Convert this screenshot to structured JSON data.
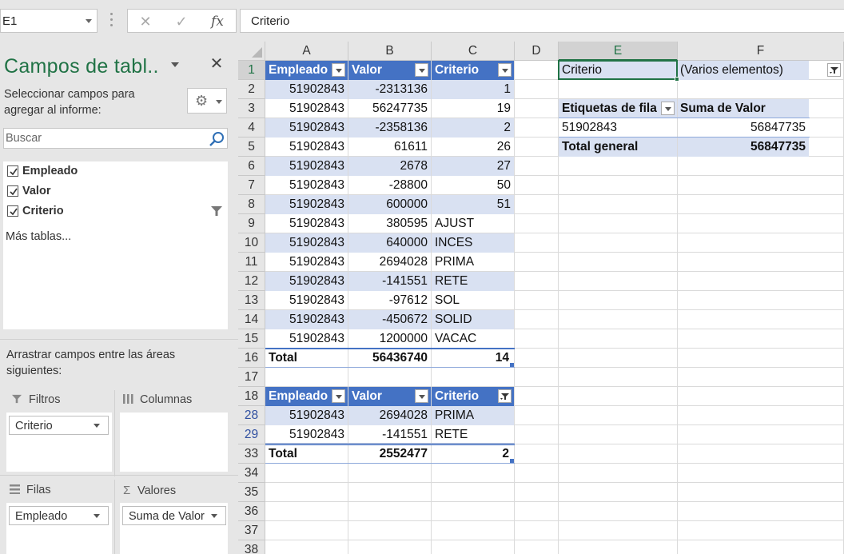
{
  "formula_bar": {
    "name_box": "E1",
    "fx_label": "fx",
    "formula": "Criterio"
  },
  "pivot_pane": {
    "title": "Campos de tabl..",
    "instructions": "Seleccionar campos para agregar al informe:",
    "search_placeholder": "Buscar",
    "fields": [
      {
        "label": "Empleado",
        "checked": true,
        "filtered": false
      },
      {
        "label": "Valor",
        "checked": true,
        "filtered": false
      },
      {
        "label": "Criterio",
        "checked": true,
        "filtered": true
      }
    ],
    "more_tables": "Más tablas...",
    "drag_instructions": "Arrastrar campos entre las áreas siguientes:",
    "areas": {
      "filters": {
        "title": "Filtros",
        "item": "Criterio"
      },
      "columns": {
        "title": "Columnas",
        "item": ""
      },
      "rows": {
        "title": "Filas",
        "item": "Empleado"
      },
      "values": {
        "title": "Valores",
        "item": "Suma de Valor"
      }
    }
  },
  "sheet": {
    "columns": [
      "A",
      "B",
      "C",
      "D",
      "E",
      "F"
    ],
    "selected_column": "E",
    "rows": [
      "1",
      "2",
      "3",
      "4",
      "5",
      "6",
      "7",
      "8",
      "9",
      "10",
      "11",
      "12",
      "13",
      "14",
      "15",
      "16",
      "17",
      "18",
      "28",
      "29",
      "33",
      "34",
      "35",
      "36",
      "37",
      "38"
    ],
    "filtered_rows": [
      "28",
      "29"
    ],
    "table1": {
      "headers": [
        "Empleado",
        "Valor",
        "Criterio"
      ],
      "data": [
        [
          "51902843",
          "-2313136",
          "1"
        ],
        [
          "51902843",
          "56247735",
          "19"
        ],
        [
          "51902843",
          "-2358136",
          "2"
        ],
        [
          "51902843",
          "61611",
          "26"
        ],
        [
          "51902843",
          "2678",
          "27"
        ],
        [
          "51902843",
          "-28800",
          "50"
        ],
        [
          "51902843",
          "600000",
          "51"
        ],
        [
          "51902843",
          "380595",
          "AJUST"
        ],
        [
          "51902843",
          "640000",
          "INCES"
        ],
        [
          "51902843",
          "2694028",
          "PRIMA"
        ],
        [
          "51902843",
          "-141551",
          "RETE"
        ],
        [
          "51902843",
          "-97612",
          "SOL"
        ],
        [
          "51902843",
          "-450672",
          "SOLID"
        ],
        [
          "51902843",
          "1200000",
          "VACAC"
        ]
      ],
      "total": [
        "Total",
        "56436740",
        "14"
      ]
    },
    "table2": {
      "headers": [
        "Empleado",
        "Valor",
        "Criterio"
      ],
      "data": [
        [
          "51902843",
          "2694028",
          "PRIMA"
        ],
        [
          "51902843",
          "-141551",
          "RETE"
        ]
      ],
      "total": [
        "Total",
        "2552477",
        "2"
      ]
    },
    "pivot": {
      "filter_label": "Criterio",
      "filter_value": "(Varios elementos)",
      "row_label_header": "Etiquetas de fila",
      "value_header": "Suma de Valor",
      "rows": [
        [
          "51902843",
          "56847735"
        ]
      ],
      "grand_total": [
        "Total general",
        "56847735"
      ]
    }
  },
  "colors": {
    "accent_green": "#217346",
    "table_header": "#4472c4",
    "table_band": "#d9e1f2"
  }
}
